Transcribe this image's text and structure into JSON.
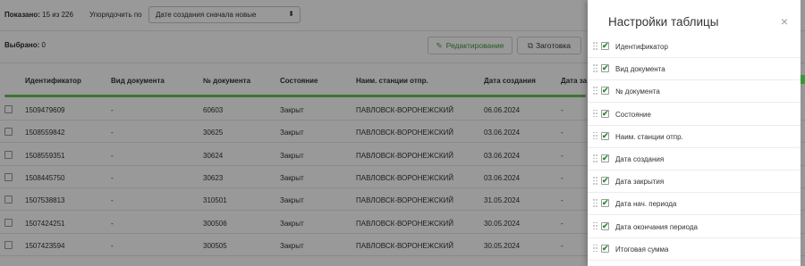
{
  "toolbar": {
    "shown_label": "Показано:",
    "shown_value": "15 из 226",
    "sort_label": "Упорядочить по",
    "sort_value": "Дате создания сначала новые",
    "selected_label": "Выбрано:",
    "selected_value": "0",
    "edit_button": "Редактирование",
    "template_button": "Заготовка"
  },
  "table": {
    "headers": {
      "id": "Идентификатор",
      "doc_type": "Вид документа",
      "doc_num": "№ документа",
      "state": "Состояние",
      "station": "Наим. станции отпр.",
      "created": "Дата создания",
      "closed_partial": "Дата за"
    },
    "rows": [
      {
        "id": "1509479609",
        "doc_type": "-",
        "doc_num": "60603",
        "state": "Закрыт",
        "station": "ПАВЛОВСК-ВОРОНЕЖСКИЙ",
        "created": "06.06.2024",
        "closed": "-"
      },
      {
        "id": "1508559842",
        "doc_type": "-",
        "doc_num": "30625",
        "state": "Закрыт",
        "station": "ПАВЛОВСК-ВОРОНЕЖСКИЙ",
        "created": "03.06.2024",
        "closed": "-"
      },
      {
        "id": "1508559351",
        "doc_type": "-",
        "doc_num": "30624",
        "state": "Закрыт",
        "station": "ПАВЛОВСК-ВОРОНЕЖСКИЙ",
        "created": "03.06.2024",
        "closed": "-"
      },
      {
        "id": "1508445750",
        "doc_type": "-",
        "doc_num": "30623",
        "state": "Закрыт",
        "station": "ПАВЛОВСК-ВОРОНЕЖСКИЙ",
        "created": "03.06.2024",
        "closed": "-"
      },
      {
        "id": "1507538813",
        "doc_type": "-",
        "doc_num": "310501",
        "state": "Закрыт",
        "station": "ПАВЛОВСК-ВОРОНЕЖСКИЙ",
        "created": "31.05.2024",
        "closed": "-"
      },
      {
        "id": "1507424251",
        "doc_type": "-",
        "doc_num": "300506",
        "state": "Закрыт",
        "station": "ПАВЛОВСК-ВОРОНЕЖСКИЙ",
        "created": "30.05.2024",
        "closed": "-"
      },
      {
        "id": "1507423594",
        "doc_type": "-",
        "doc_num": "300505",
        "state": "Закрыт",
        "station": "ПАВЛОВСК-ВОРОНЕЖСКИЙ",
        "created": "30.05.2024",
        "closed": "-"
      }
    ]
  },
  "settings_panel": {
    "title": "Настройки таблицы",
    "close_glyph": "×",
    "check_glyph": "✔",
    "items": [
      {
        "label": "Идентификатор",
        "checked": true
      },
      {
        "label": "Вид документа",
        "checked": true
      },
      {
        "label": "№ документа",
        "checked": true
      },
      {
        "label": "Состояние",
        "checked": true
      },
      {
        "label": "Наим. станции отпр.",
        "checked": true
      },
      {
        "label": "Дата создания",
        "checked": true
      },
      {
        "label": "Дата закрытия",
        "checked": true
      },
      {
        "label": "Дата нач. периода",
        "checked": true
      },
      {
        "label": "Дата окончания периода",
        "checked": true
      },
      {
        "label": "Итоговая сумма",
        "checked": true
      }
    ]
  },
  "colors": {
    "accent_green": "#3a9c3a",
    "progress_green": "#6dbf5a",
    "overlay": "rgba(0,0,0,0.4)"
  },
  "icons": {
    "edit": "pencil-icon",
    "template": "copy-icon",
    "sort_dropdown": "sort-arrows-icon",
    "close": "close-icon",
    "drag": "drag-handle-icon"
  }
}
